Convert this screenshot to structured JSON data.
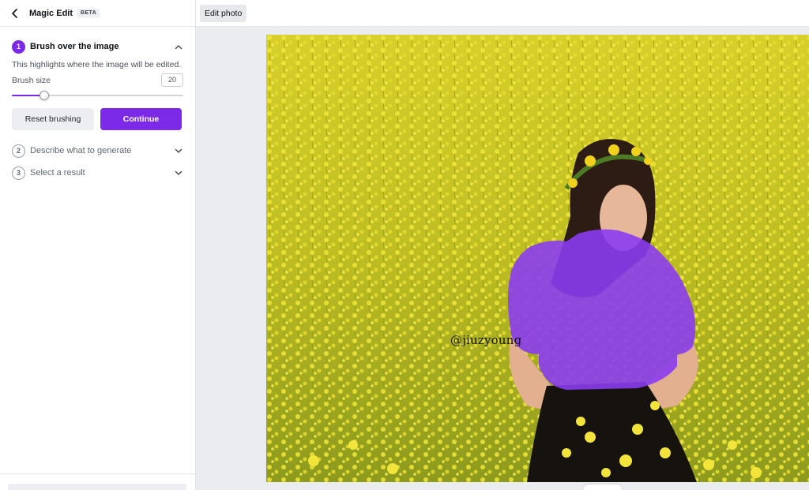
{
  "sidebar": {
    "title": "Magic Edit",
    "badge": "BETA",
    "steps": [
      {
        "number": "1",
        "label": "Brush over the image",
        "state": "expanded"
      },
      {
        "number": "2",
        "label": "Describe what to generate",
        "state": "collapsed"
      },
      {
        "number": "3",
        "label": "Select a result",
        "state": "collapsed"
      }
    ],
    "step1": {
      "description": "This highlights where the image will be edited.",
      "brush_size_label": "Brush size",
      "brush_size_value": "20",
      "slider_fraction": 0.19,
      "reset_label": "Reset brushing",
      "continue_label": "Continue"
    }
  },
  "toolbar": {
    "edit_photo_label": "Edit photo"
  },
  "canvas": {
    "watermark": "@jiuzyoung"
  },
  "colors": {
    "accent": "#7d2ae8",
    "brush_overlay": "#8a3cf0",
    "field": "#c9c21f"
  },
  "icons": {
    "back": "chevron-left-icon",
    "expand": "chevron-up-icon",
    "collapse": "chevron-down-icon"
  }
}
